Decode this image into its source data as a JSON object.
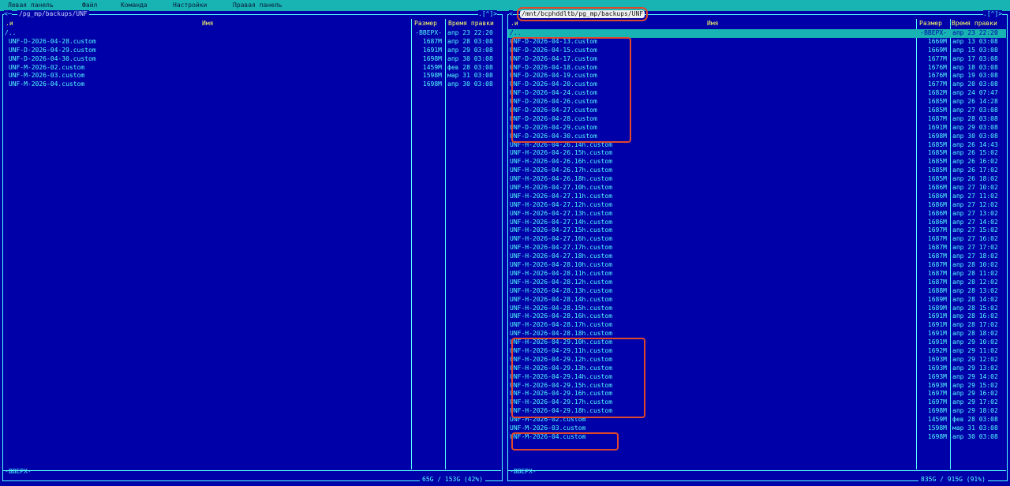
{
  "menu": [
    "Левая панель",
    "Файл",
    "Команда",
    "Настройки",
    "Правая панель"
  ],
  "columns": {
    "name": "Имя",
    "size": "Размер",
    "mtime": "Время правки",
    "sort": ".и"
  },
  "left": {
    "path": "/pg_mp/backups/UNF",
    "ctl_left": "<─",
    "ctl_right": ".[^]>",
    "status": "-ВВЕРХ-",
    "usage": "65G / 153G (42%)",
    "files": [
      {
        "name": "/..",
        "size": "-ВВЕРХ-",
        "mtime": "апр 23 22:20"
      },
      {
        "name": " UNF-D-2026-04-28.custom",
        "size": "1687M",
        "mtime": "апр 28 03:08"
      },
      {
        "name": " UNF-D-2026-04-29.custom",
        "size": "1691M",
        "mtime": "апр 29 03:08"
      },
      {
        "name": " UNF-D-2026-04-30.custom",
        "size": "1698M",
        "mtime": "апр 30 03:08"
      },
      {
        "name": " UNF-M-2026-02.custom",
        "size": "1459M",
        "mtime": "фев 28 03:08"
      },
      {
        "name": " UNF-M-2026-03.custom",
        "size": "1598M",
        "mtime": "мар 31 03:08"
      },
      {
        "name": " UNF-M-2026-04.custom",
        "size": "1698M",
        "mtime": "апр 30 03:08"
      }
    ]
  },
  "right": {
    "path": "/mnt/bcphddltb/pg_mp/backups/UNF",
    "ctl_left": "<",
    "ctl_right": ".[^]>",
    "status": "-ВВЕРХ-",
    "usage": "835G / 915G (91%)",
    "selected_index": 0,
    "files": [
      {
        "name": "/..",
        "size": "-ВВЕРХ-",
        "mtime": "апр 23 22:20"
      },
      {
        "name": "UNF-D-2026-04-13.custom",
        "size": "1660M",
        "mtime": "апр 13 03:08"
      },
      {
        "name": "UNF-D-2026-04-15.custom",
        "size": "1669M",
        "mtime": "апр 15 03:08"
      },
      {
        "name": "UNF-D-2026-04-17.custom",
        "size": "1677M",
        "mtime": "апр 17 03:08"
      },
      {
        "name": "UNF-D-2026-04-18.custom",
        "size": "1676M",
        "mtime": "апр 18 03:08"
      },
      {
        "name": "UNF-D-2026-04-19.custom",
        "size": "1676M",
        "mtime": "апр 19 03:08"
      },
      {
        "name": "UNF-D-2026-04-20.custom",
        "size": "1677M",
        "mtime": "апр 20 03:08"
      },
      {
        "name": "UNF-D-2026-04-24.custom",
        "size": "1682M",
        "mtime": "апр 24 07:47"
      },
      {
        "name": "UNF-D-2026-04-26.custom",
        "size": "1685M",
        "mtime": "апр 26 14:28"
      },
      {
        "name": "UNF-D-2026-04-27.custom",
        "size": "1685M",
        "mtime": "апр 27 03:08"
      },
      {
        "name": "UNF-D-2026-04-28.custom",
        "size": "1687M",
        "mtime": "апр 28 03:08"
      },
      {
        "name": "UNF-D-2026-04-29.custom",
        "size": "1691M",
        "mtime": "апр 29 03:08"
      },
      {
        "name": "UNF-D-2026-04-30.custom",
        "size": "1698M",
        "mtime": "апр 30 03:08"
      },
      {
        "name": "UNF-H-2026-04-26.14h.custom",
        "size": "1685M",
        "mtime": "апр 26 14:43"
      },
      {
        "name": "UNF-H-2026-04-26.15h.custom",
        "size": "1685M",
        "mtime": "апр 26 15:02"
      },
      {
        "name": "UNF-H-2026-04-26.16h.custom",
        "size": "1685M",
        "mtime": "апр 26 16:02"
      },
      {
        "name": "UNF-H-2026-04-26.17h.custom",
        "size": "1685M",
        "mtime": "апр 26 17:02"
      },
      {
        "name": "UNF-H-2026-04-26.18h.custom",
        "size": "1685M",
        "mtime": "апр 26 18:02"
      },
      {
        "name": "UNF-H-2026-04-27.10h.custom",
        "size": "1686M",
        "mtime": "апр 27 10:02"
      },
      {
        "name": "UNF-H-2026-04-27.11h.custom",
        "size": "1686M",
        "mtime": "апр 27 11:02"
      },
      {
        "name": "UNF-H-2026-04-27.12h.custom",
        "size": "1686M",
        "mtime": "апр 27 12:02"
      },
      {
        "name": "UNF-H-2026-04-27.13h.custom",
        "size": "1686M",
        "mtime": "апр 27 13:02"
      },
      {
        "name": "UNF-H-2026-04-27.14h.custom",
        "size": "1686M",
        "mtime": "апр 27 14:02"
      },
      {
        "name": "UNF-H-2026-04-27.15h.custom",
        "size": "1697M",
        "mtime": "апр 27 15:02"
      },
      {
        "name": "UNF-H-2026-04-27.16h.custom",
        "size": "1687M",
        "mtime": "апр 27 16:02"
      },
      {
        "name": "UNF-H-2026-04-27.17h.custom",
        "size": "1687M",
        "mtime": "апр 27 17:02"
      },
      {
        "name": "UNF-H-2026-04-27.18h.custom",
        "size": "1687M",
        "mtime": "апр 27 18:02"
      },
      {
        "name": "UNF-H-2026-04-28.10h.custom",
        "size": "1687M",
        "mtime": "апр 28 10:02"
      },
      {
        "name": "UNF-H-2026-04-28.11h.custom",
        "size": "1687M",
        "mtime": "апр 28 11:02"
      },
      {
        "name": "UNF-H-2026-04-28.12h.custom",
        "size": "1687M",
        "mtime": "апр 28 12:02"
      },
      {
        "name": "UNF-H-2026-04-28.13h.custom",
        "size": "1688M",
        "mtime": "апр 28 13:02"
      },
      {
        "name": "UNF-H-2026-04-28.14h.custom",
        "size": "1689M",
        "mtime": "апр 28 14:02"
      },
      {
        "name": "UNF-H-2026-04-28.15h.custom",
        "size": "1689M",
        "mtime": "апр 28 15:02"
      },
      {
        "name": "UNF-H-2026-04-28.16h.custom",
        "size": "1691M",
        "mtime": "апр 28 16:02"
      },
      {
        "name": "UNF-H-2026-04-28.17h.custom",
        "size": "1691M",
        "mtime": "апр 28 17:02"
      },
      {
        "name": "UNF-H-2026-04-28.18h.custom",
        "size": "1691M",
        "mtime": "апр 28 18:02"
      },
      {
        "name": "UNF-H-2026-04-29.10h.custom",
        "size": "1691M",
        "mtime": "апр 29 10:02"
      },
      {
        "name": "UNF-H-2026-04-29.11h.custom",
        "size": "1692M",
        "mtime": "апр 29 11:02"
      },
      {
        "name": "UNF-H-2026-04-29.12h.custom",
        "size": "1693M",
        "mtime": "апр 29 12:02"
      },
      {
        "name": "UNF-H-2026-04-29.13h.custom",
        "size": "1693M",
        "mtime": "апр 29 13:02"
      },
      {
        "name": "UNF-H-2026-04-29.14h.custom",
        "size": "1693M",
        "mtime": "апр 29 14:02"
      },
      {
        "name": "UNF-H-2026-04-29.15h.custom",
        "size": "1693M",
        "mtime": "апр 29 15:02"
      },
      {
        "name": "UNF-H-2026-04-29.16h.custom",
        "size": "1697M",
        "mtime": "апр 29 16:02"
      },
      {
        "name": "UNF-H-2026-04-29.17h.custom",
        "size": "1697M",
        "mtime": "апр 29 17:02"
      },
      {
        "name": "UNF-H-2026-04-29.18h.custom",
        "size": "1698M",
        "mtime": "апр 29 18:02"
      },
      {
        "name": "UNF-M-2026-02.custom",
        "size": "1459M",
        "mtime": "фев 28 03:08"
      },
      {
        "name": "UNF-M-2026-03.custom",
        "size": "1598M",
        "mtime": "мар 31 03:08"
      },
      {
        "name": "UNF-M-2026-04.custom",
        "size": "1698M",
        "mtime": "апр 30 03:08"
      }
    ]
  }
}
